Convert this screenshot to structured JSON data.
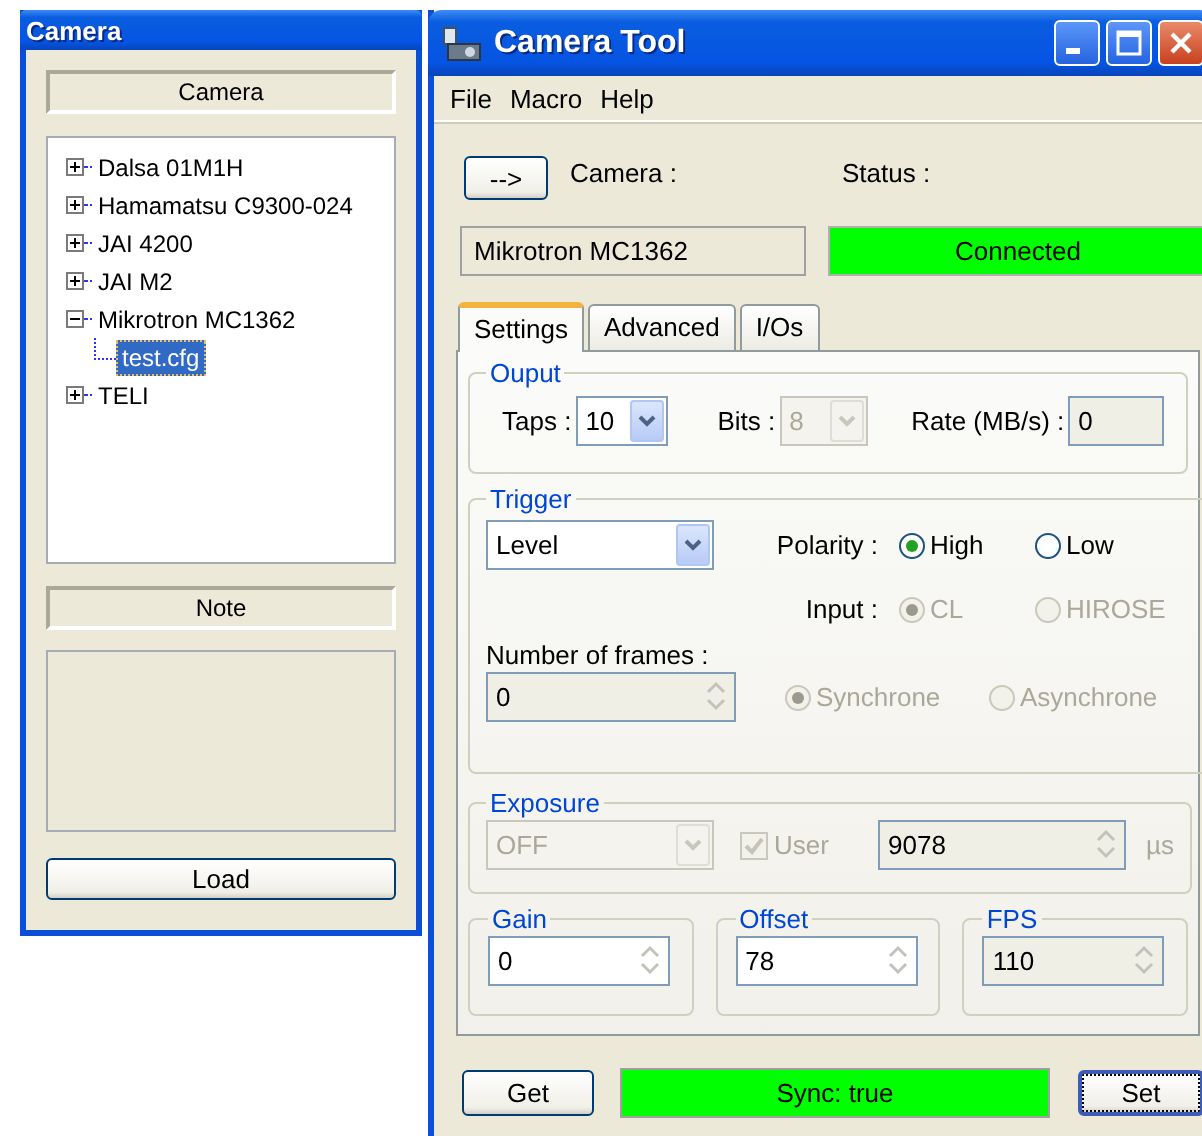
{
  "camera_window": {
    "title": "Camera",
    "camera_header": "Camera",
    "tree": [
      {
        "label": "Dalsa 01M1H",
        "expanded": false,
        "selected": false
      },
      {
        "label": "Hamamatsu C9300-024",
        "expanded": false,
        "selected": false
      },
      {
        "label": "JAI 4200",
        "expanded": false,
        "selected": false
      },
      {
        "label": "JAI M2",
        "expanded": false,
        "selected": false
      },
      {
        "label": "Mikrotron MC1362",
        "expanded": true,
        "selected": false,
        "children": [
          {
            "label": "test.cfg",
            "selected": true
          }
        ]
      },
      {
        "label": "TELI",
        "expanded": false,
        "selected": false
      }
    ],
    "note_header": "Note",
    "load_button": "Load"
  },
  "tool_window": {
    "title": "Camera Tool",
    "menu": [
      "File",
      "Macro",
      "Help"
    ],
    "arrow_button": "-->",
    "camera_label": "Camera :",
    "status_label": "Status :",
    "camera_value": "Mikrotron MC1362",
    "status": {
      "text": "Connected",
      "color": "#00ff00"
    },
    "tabs": [
      {
        "label": "Settings",
        "selected": true
      },
      {
        "label": "Advanced",
        "selected": false
      },
      {
        "label": "I/Os",
        "selected": false
      }
    ],
    "output": {
      "title": "Ouput",
      "fields": [
        {
          "label": "Taps :",
          "kind": "combo",
          "value": "10",
          "disabled": false
        },
        {
          "label": "Bits :",
          "kind": "combo",
          "value": "8",
          "disabled": true
        },
        {
          "label": "Rate (MB/s) :",
          "kind": "text",
          "value": "0",
          "readonly": true
        }
      ]
    },
    "trigger": {
      "title": "Trigger",
      "mode": {
        "kind": "combo",
        "value": "Level",
        "disabled": false
      },
      "polarity": {
        "label": "Polarity :",
        "options": [
          {
            "label": "High",
            "selected": true,
            "disabled": false
          },
          {
            "label": "Low",
            "selected": false,
            "disabled": false
          }
        ]
      },
      "input": {
        "label": "Input :",
        "options": [
          {
            "label": "CL",
            "selected": true,
            "disabled": true
          },
          {
            "label": "HIROSE",
            "selected": false,
            "disabled": true
          }
        ]
      },
      "frames_label": "Number of frames :",
      "frames": {
        "kind": "spinner",
        "value": "0",
        "readonly": true
      },
      "sync_mode": [
        {
          "label": "Synchrone",
          "selected": true,
          "disabled": true
        },
        {
          "label": "Asynchrone",
          "selected": false,
          "disabled": true
        }
      ]
    },
    "exposure": {
      "title": "Exposure",
      "mode": {
        "kind": "combo",
        "value": "OFF",
        "disabled": true
      },
      "user": {
        "label": "User",
        "checked": true,
        "disabled": true
      },
      "value": {
        "kind": "spinner",
        "value": "9078",
        "readonly": true
      },
      "unit": "µs"
    },
    "params": [
      {
        "title": "Gain",
        "field": {
          "kind": "spinner",
          "value": "0",
          "readonly": false
        }
      },
      {
        "title": "Offset",
        "field": {
          "kind": "spinner",
          "value": "78",
          "readonly": false
        }
      },
      {
        "title": "FPS",
        "field": {
          "kind": "spinner",
          "value": "110",
          "readonly": true
        }
      }
    ],
    "get_button": "Get",
    "sync": {
      "text": "Sync: true",
      "color": "#00ff00"
    },
    "set_button": {
      "label": "Set",
      "focused": true
    }
  }
}
